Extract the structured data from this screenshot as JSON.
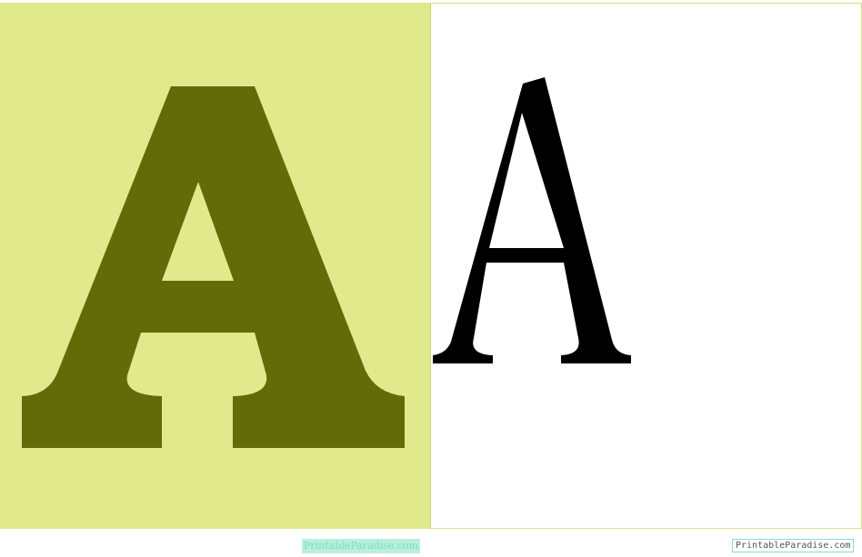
{
  "letter": {
    "character": "A",
    "bold_fill": "#636a08",
    "bold_background": "#e0ea8d",
    "outline_fill": "#000000",
    "outline_background": "#ffffff"
  },
  "watermarks": {
    "left": "PrintableParadise.com",
    "right": "PrintableParadise.com"
  }
}
